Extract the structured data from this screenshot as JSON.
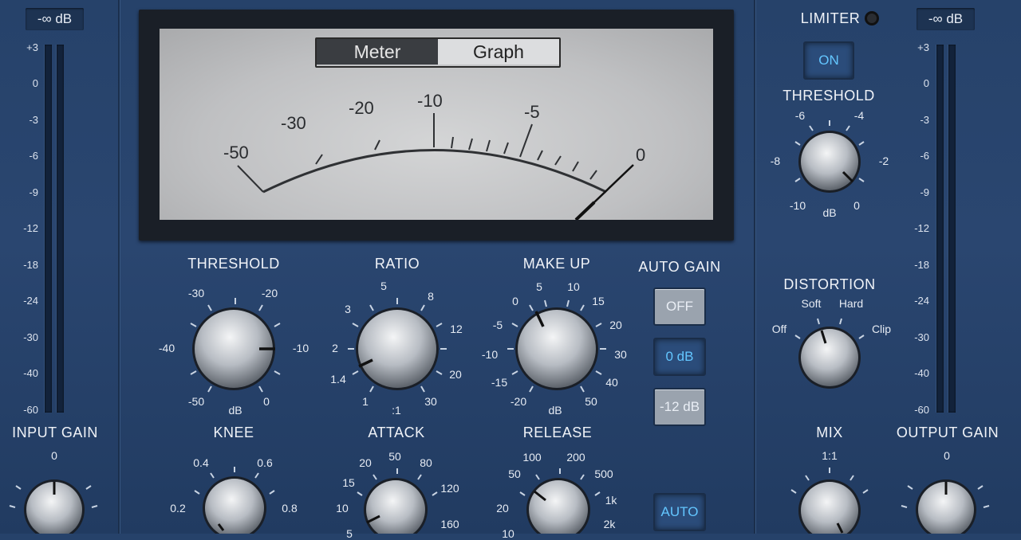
{
  "input": {
    "readout": "-∞ dB",
    "scale": [
      "+3",
      "0",
      "-3",
      "-6",
      "-9",
      "-12",
      "-18",
      "-24",
      "-30",
      "-40",
      "-60"
    ],
    "label": "INPUT GAIN",
    "knob_labels": [
      "0"
    ]
  },
  "output": {
    "readout": "-∞ dB",
    "scale": [
      "+3",
      "0",
      "-3",
      "-6",
      "-9",
      "-12",
      "-18",
      "-24",
      "-30",
      "-40",
      "-60"
    ],
    "label": "OUTPUT GAIN",
    "knob_labels": [
      "0"
    ]
  },
  "meter": {
    "tabs": [
      "Meter",
      "Graph"
    ],
    "selected_tab": "Meter",
    "scale": [
      "-50",
      "-30",
      "-20",
      "-10",
      "-5",
      "0"
    ]
  },
  "threshold": {
    "label": "THRESHOLD",
    "unit": "dB",
    "marks": [
      "-30",
      "-20",
      "-40",
      "-10",
      "-50",
      "0"
    ]
  },
  "ratio": {
    "label": "RATIO",
    "unit": ":1",
    "marks": [
      "5",
      "3",
      "8",
      "2",
      "12",
      "1.4",
      "20",
      "1",
      "30"
    ]
  },
  "makeup": {
    "label": "MAKE UP",
    "unit": "dB",
    "marks": [
      "5",
      "10",
      "0",
      "15",
      "-5",
      "20",
      "-10",
      "30",
      "-15",
      "40",
      "-20",
      "50"
    ]
  },
  "auto_gain": {
    "label": "AUTO GAIN",
    "buttons": [
      "OFF",
      "0 dB",
      "-12 dB"
    ],
    "selected": "0 dB"
  },
  "knee": {
    "label": "KNEE",
    "marks": [
      "0.4",
      "0.6",
      "0.2",
      "0.8"
    ]
  },
  "attack": {
    "label": "ATTACK",
    "marks": [
      "50",
      "20",
      "80",
      "15",
      "120",
      "10",
      "160",
      "5"
    ]
  },
  "release": {
    "label": "RELEASE",
    "marks": [
      "100",
      "200",
      "50",
      "500",
      "20",
      "1k",
      "10",
      "2k"
    ]
  },
  "auto_button": "AUTO",
  "limiter": {
    "label": "LIMITER",
    "on_button": "ON",
    "threshold_label": "THRESHOLD",
    "marks": [
      "-6",
      "-4",
      "-8",
      "-2",
      "-10",
      "dB",
      "0"
    ]
  },
  "distortion": {
    "label": "DISTORTION",
    "marks": [
      "Soft",
      "Hard",
      "Off",
      "Clip"
    ]
  },
  "mix": {
    "label": "MIX",
    "marks": [
      "1:1"
    ]
  },
  "colors": {
    "lit_text": "#63c6ff",
    "panel": "#26426a"
  }
}
